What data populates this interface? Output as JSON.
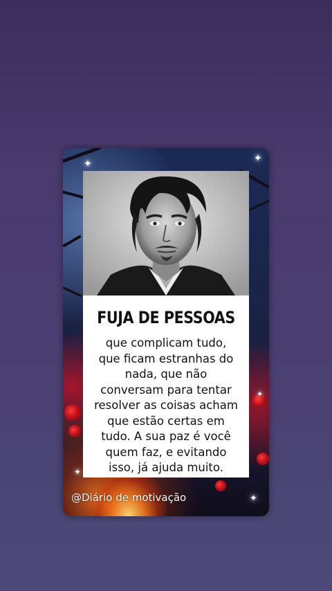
{
  "post": {
    "headline": "FUJA DE PESSOAS",
    "body_lines": [
      "que complicam tudo,",
      "que ficam estranhas do",
      "nada, que não",
      "conversam para tentar",
      "resolver as coisas acham",
      "que estão certas em",
      "tudo. A sua paz é você",
      "quem faz, e evitando",
      "isso, já ajuda muito."
    ],
    "watermark": "@Diário de motivação"
  },
  "colors": {
    "background_top": "#3d2d5c",
    "background_bottom": "#4d4a78",
    "panel": "#ffffff",
    "text": "#111111"
  },
  "icons": [
    "sparkle-icon",
    "portrait-image"
  ]
}
